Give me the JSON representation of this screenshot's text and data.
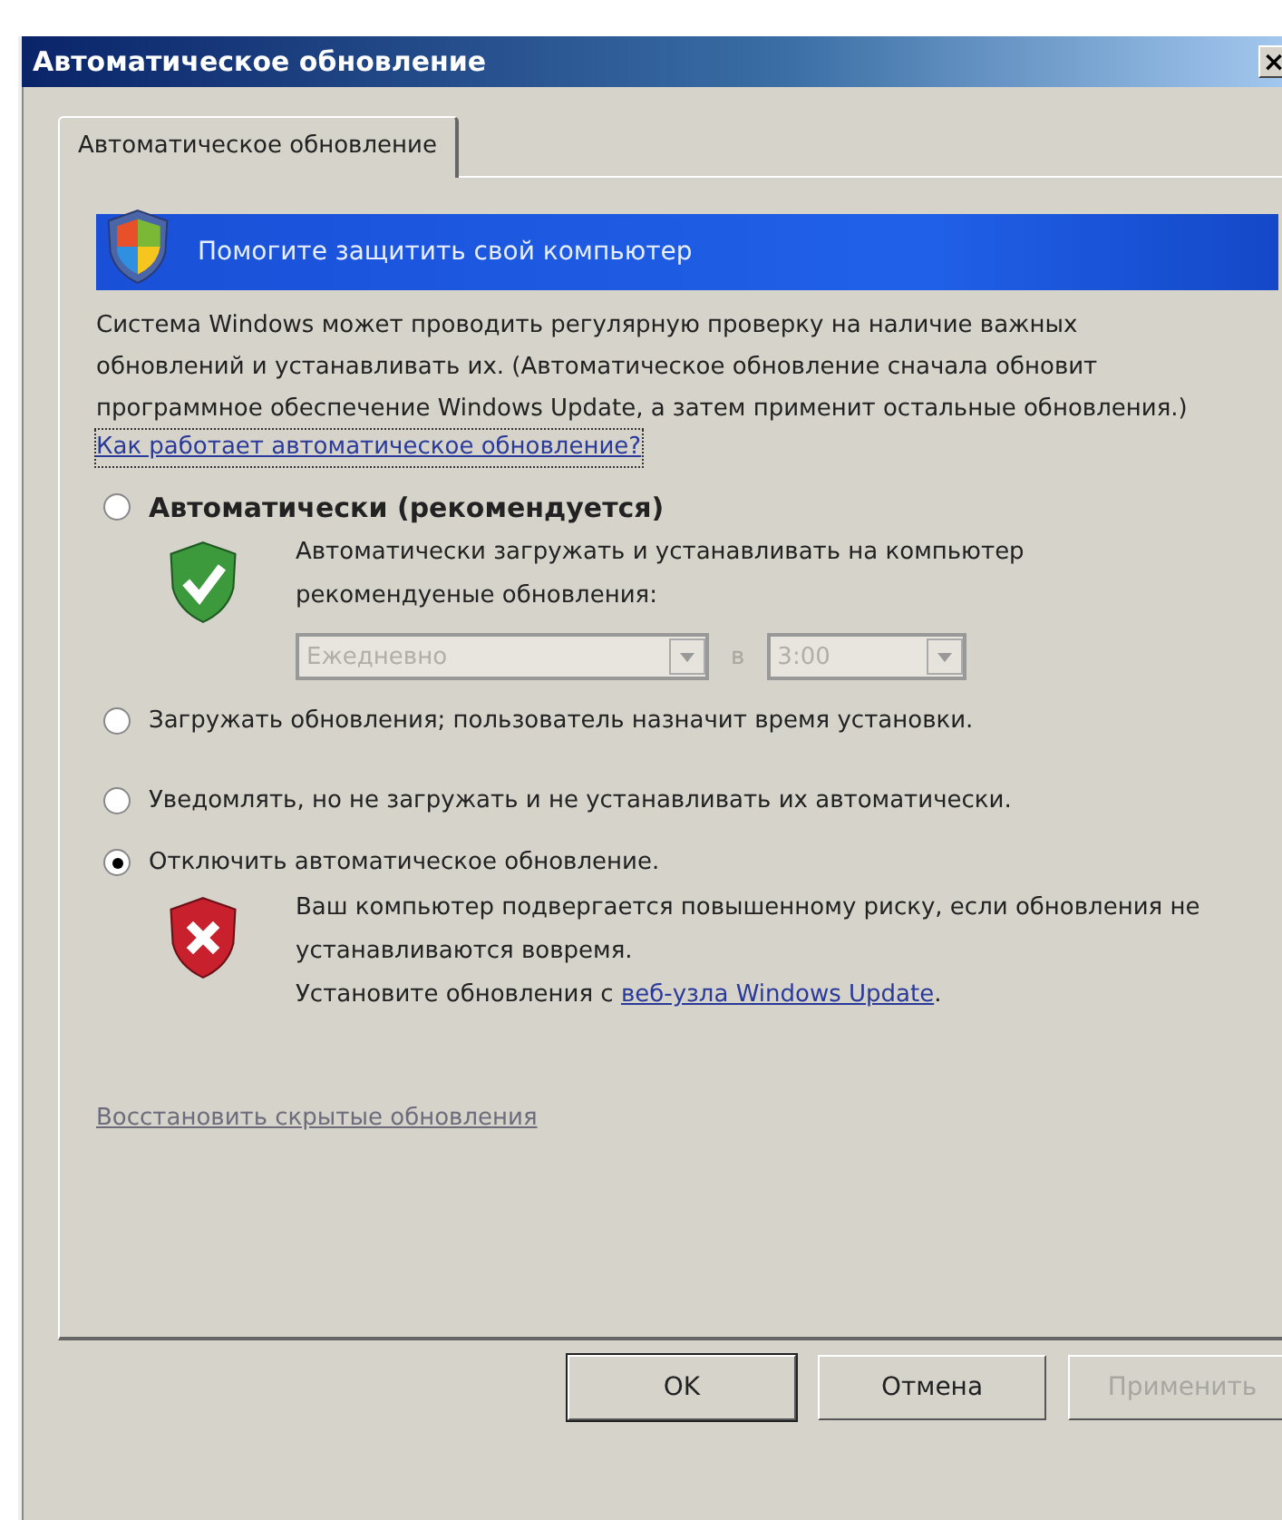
{
  "window": {
    "title": "Автоматическое обновление",
    "close": "×"
  },
  "tabs": [
    {
      "label": "Автоматическое обновление",
      "selected": true
    }
  ],
  "banner": {
    "text": "Помогите защитить свой компьютер"
  },
  "intro": "Система Windows может проводить регулярную проверку на наличие важных обновлений и устанавливать их. (Автоматическое обновление сначала обновит программное обеспечение Windows Update, а затем применит остальные обновления.)",
  "help_link": {
    "text": "Как работает автоматическое обновление?",
    "focused": true
  },
  "options": [
    {
      "label": "Автоматически (рекомендуется)",
      "selected": false,
      "bold": true
    },
    {
      "label": "Загружать обновления; пользователь назначит время установки.",
      "selected": false,
      "bold": false
    },
    {
      "label": "Уведомлять, но не загружать и не устанавливать их автоматически.",
      "selected": false,
      "bold": false
    },
    {
      "label": "Отключить автоматическое обновление.",
      "selected": true,
      "bold": false
    }
  ],
  "auto_details": {
    "description": "Автоматически загружать и устанавливать на компьютер рекомендуеные обновления:",
    "frequency": {
      "value": "Ежедневно",
      "disabled": true
    },
    "at_label": "в",
    "time": {
      "value": "3:00",
      "disabled": true
    }
  },
  "warning": {
    "text": "Ваш компьютер подвергается повышенному риску, если обновления не устанавливаются вовремя.",
    "install_prefix": "Установите обновления с ",
    "link": "веб-узла Windows Update",
    "suffix": "."
  },
  "restore_link": {
    "text": "Восстановить скрытые обновления",
    "disabled": true
  },
  "buttons": [
    {
      "label": "OK",
      "default": true,
      "disabled": false
    },
    {
      "label": "Отмена",
      "default": false,
      "disabled": false
    },
    {
      "label": "Применить",
      "default": false,
      "disabled": true
    }
  ]
}
